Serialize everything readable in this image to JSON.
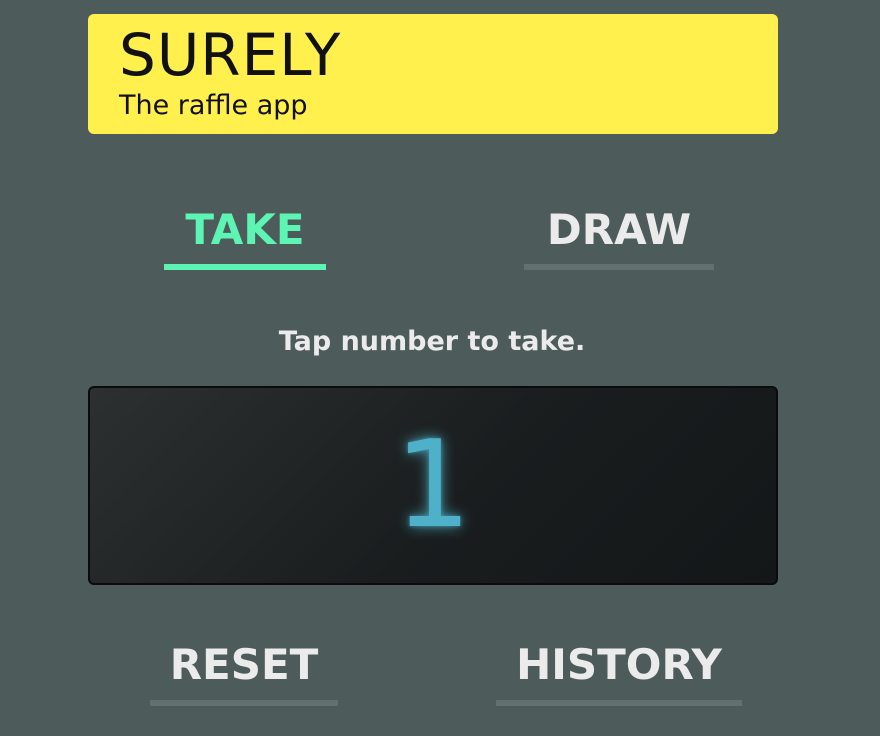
{
  "header": {
    "title": "SURELY",
    "subtitle": "The raffle app",
    "background_color": "#fff04d"
  },
  "tabs": [
    {
      "label": "TAKE",
      "active": true
    },
    {
      "label": "DRAW",
      "active": false
    }
  ],
  "instruction": "Tap number to take.",
  "display": {
    "number": "1",
    "number_color": "#4fb1c9"
  },
  "actions": {
    "reset_label": "RESET",
    "history_label": "HISTORY"
  },
  "colors": {
    "background": "#4d5b5b",
    "accent": "#5df5b4",
    "text": "#ebebeb",
    "inactive_underline": "#627070"
  }
}
